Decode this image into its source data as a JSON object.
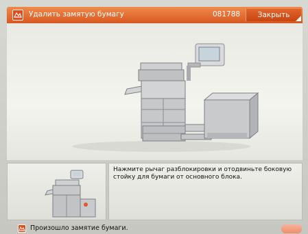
{
  "header": {
    "title": "Удалить замятую бумагу",
    "job_number": "081788",
    "close_label": "Закрыть",
    "accent_color": "#d8571f"
  },
  "illustration": {
    "icon": "printer-with-paper-deck-illustration"
  },
  "instruction": {
    "text": "Нажмите рычаг разблокировки и отодвиньте боковую стойку для бумаги от основного блока."
  },
  "status": {
    "message": "Произошло замятие бумаги.",
    "icon": "paper-jam-icon"
  }
}
